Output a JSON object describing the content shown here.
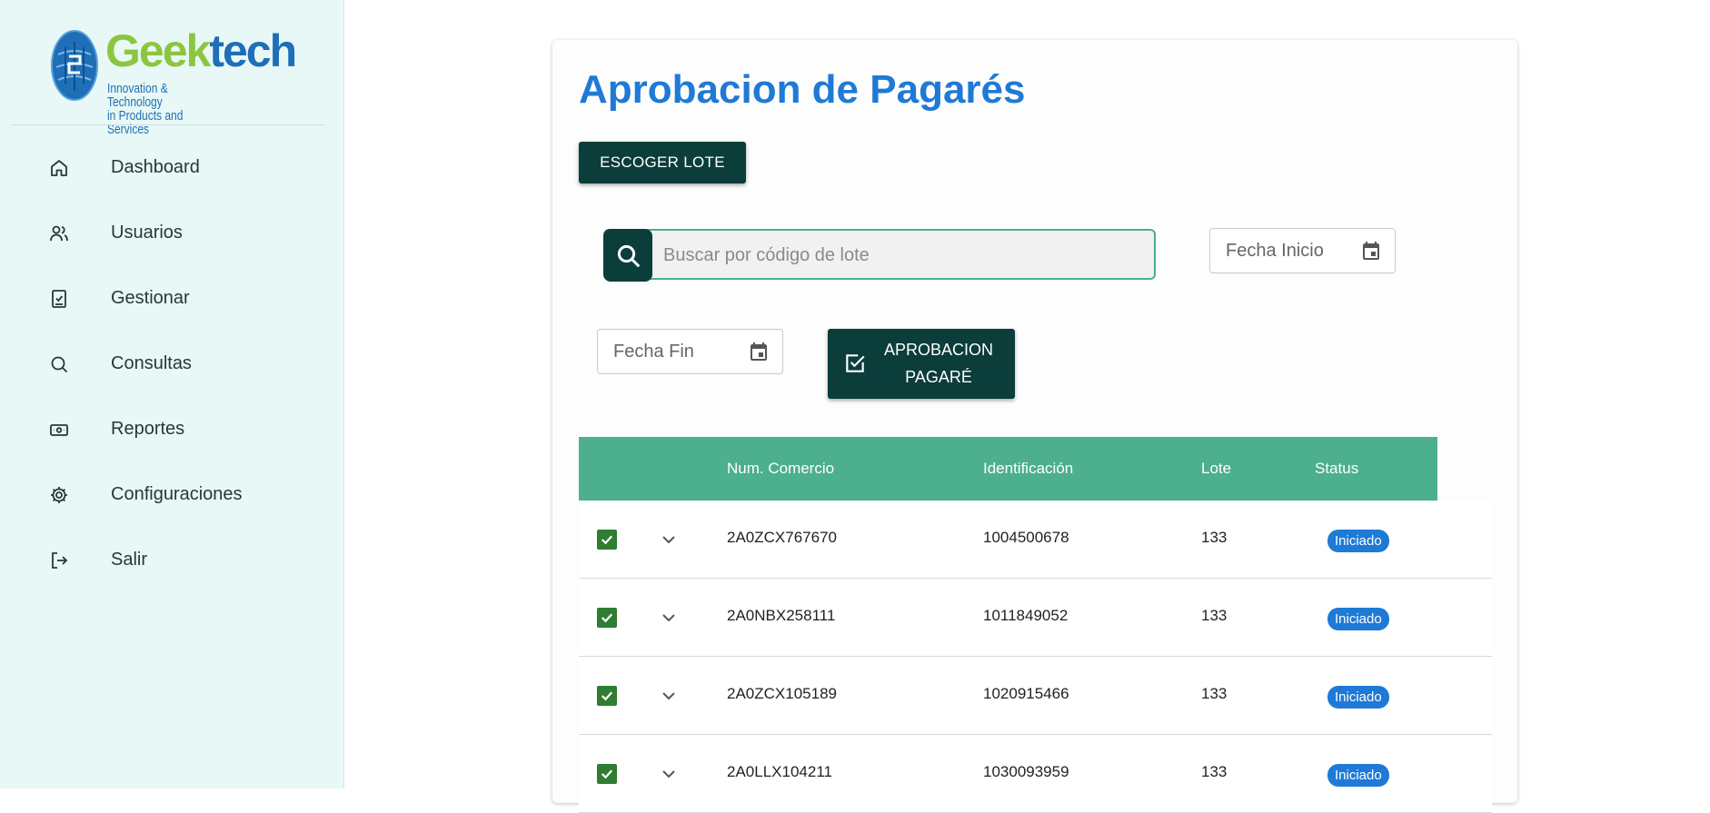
{
  "logo": {
    "word_a": "Geek",
    "word_b": "tech",
    "tagline_1": "Innovation & Technology",
    "tagline_2": "in Products and Services"
  },
  "sidebar": {
    "items": [
      {
        "label": "Dashboard",
        "icon": "home-icon"
      },
      {
        "label": "Usuarios",
        "icon": "users-icon"
      },
      {
        "label": "Gestionar",
        "icon": "clipboard-check-icon"
      },
      {
        "label": "Consultas",
        "icon": "search-icon"
      },
      {
        "label": "Reportes",
        "icon": "cash-icon"
      },
      {
        "label": "Configuraciones",
        "icon": "gear-icon"
      },
      {
        "label": "Salir",
        "icon": "logout-icon"
      }
    ]
  },
  "main": {
    "title": "Aprobacion de Pagarés",
    "choose_batch_label": "ESCOGER LOTE",
    "search_placeholder": "Buscar por código de lote",
    "date_start_label": "Fecha Inicio",
    "date_end_label": "Fecha Fin",
    "approve_label": "APROBACION\nPAGARÉ"
  },
  "table": {
    "columns": [
      "Num. Comercio",
      "Identificación",
      "Lote",
      "Status"
    ],
    "rows": [
      {
        "checked": true,
        "comercio": "2A0ZCX767670",
        "identificacion": "1004500678",
        "lote": "133",
        "status": "Iniciado"
      },
      {
        "checked": true,
        "comercio": "2A0NBX258111",
        "identificacion": "1011849052",
        "lote": "133",
        "status": "Iniciado"
      },
      {
        "checked": true,
        "comercio": "2A0ZCX105189",
        "identificacion": "1020915466",
        "lote": "133",
        "status": "Iniciado"
      },
      {
        "checked": true,
        "comercio": "2A0LLX104211",
        "identificacion": "1030093959",
        "lote": "133",
        "status": "Iniciado"
      }
    ]
  },
  "colors": {
    "accent": "#1e7ad6",
    "dark_button": "#0b3d3a",
    "table_header": "#4caf8e",
    "sidebar_bg": "#e8f8f6",
    "checkbox": "#2e7d32"
  }
}
